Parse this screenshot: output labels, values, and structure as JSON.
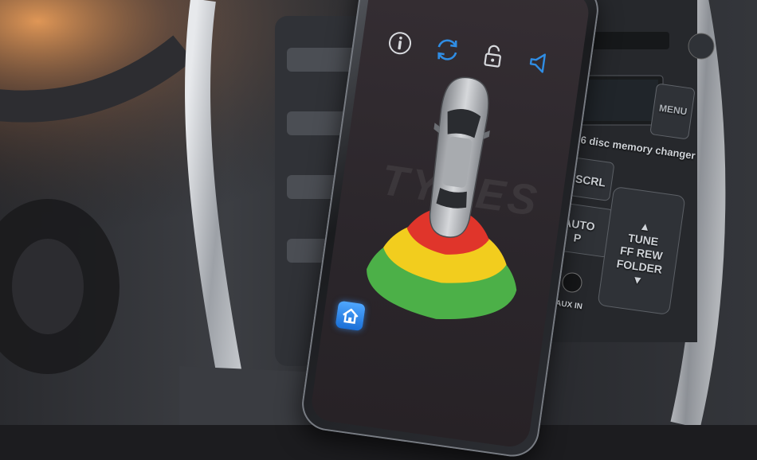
{
  "colors": {
    "zone_near": "#e0352b",
    "zone_mid": "#f2cd1e",
    "zone_far": "#4cb048",
    "icon_accent": "#2f8de4",
    "home_button": "#2a83e8"
  },
  "app": {
    "toolbar": [
      {
        "icon": "info-icon"
      },
      {
        "icon": "refresh-icon"
      },
      {
        "icon": "lock-icon"
      },
      {
        "icon": "speaker-icon"
      }
    ],
    "watermark": "TYRES",
    "home_icon": "home-icon"
  },
  "dashboard": {
    "menu_label": "MENU",
    "disc_label": "6 disc memory changer",
    "scrl_label": "SCRL",
    "auto_label": "AUTO",
    "auto_sub": "P",
    "tune_label": "TUNE",
    "ffrew_label": "FF REW",
    "folder_label": "FOLDER",
    "aux_label": "AUX IN"
  }
}
